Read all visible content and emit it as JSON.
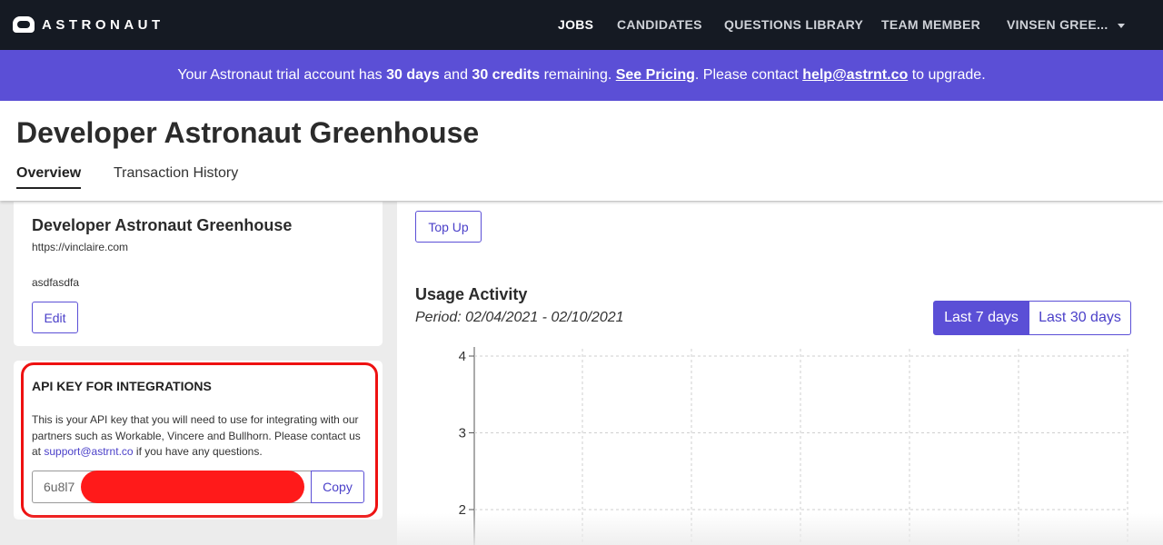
{
  "nav": {
    "logo_text": "ASTRONAUT",
    "items": [
      {
        "label": "JOBS",
        "active": true
      },
      {
        "label": "CANDIDATES"
      },
      {
        "label": "QUESTIONS LIBRARY"
      },
      {
        "label": "TEAM MEMBER"
      },
      {
        "label": "VINSEN GREE..."
      }
    ]
  },
  "banner": {
    "text1": "Your Astronaut trial account has ",
    "days": "30 days",
    "text2": " and ",
    "credits": "30 credits",
    "text3": " remaining. ",
    "pricing_link": "See Pricing",
    "text4": ". Please contact ",
    "email_link": "help@astrnt.co",
    "text5": " to upgrade."
  },
  "header": {
    "title": "Developer Astronaut Greenhouse",
    "tabs": [
      {
        "label": "Overview",
        "active": true
      },
      {
        "label": "Transaction History"
      }
    ]
  },
  "company": {
    "name": "Developer Astronaut Greenhouse",
    "url": "https://vinclaire.com",
    "description": "asdfasdfa",
    "edit_label": "Edit"
  },
  "api": {
    "heading": "API KEY FOR INTEGRATIONS",
    "desc1": "This is your API key that you will need to use for integrating with our partners such as Workable, Vincere and Bullhorn. Please contact us at ",
    "support_link": "support@astrnt.co",
    "desc2": " if you have any questions.",
    "key_value": "6u8l7",
    "copy_label": "Copy"
  },
  "usage": {
    "topup_label": "Top Up",
    "title": "Usage Activity",
    "period": "Period: 02/04/2021 - 02/10/2021",
    "ranges": [
      {
        "label": "Last 7 days",
        "active": true
      },
      {
        "label": "Last 30 days"
      }
    ]
  },
  "chart_data": {
    "type": "line",
    "title": "",
    "xlabel": "",
    "ylabel": "",
    "y_ticks_visible": [
      4,
      3,
      2
    ],
    "ylim": [
      0,
      4
    ],
    "grid": true,
    "series": []
  },
  "colors": {
    "nav_bg": "#151a23",
    "accent": "#5b4fd6",
    "highlight": "#ee1111"
  }
}
